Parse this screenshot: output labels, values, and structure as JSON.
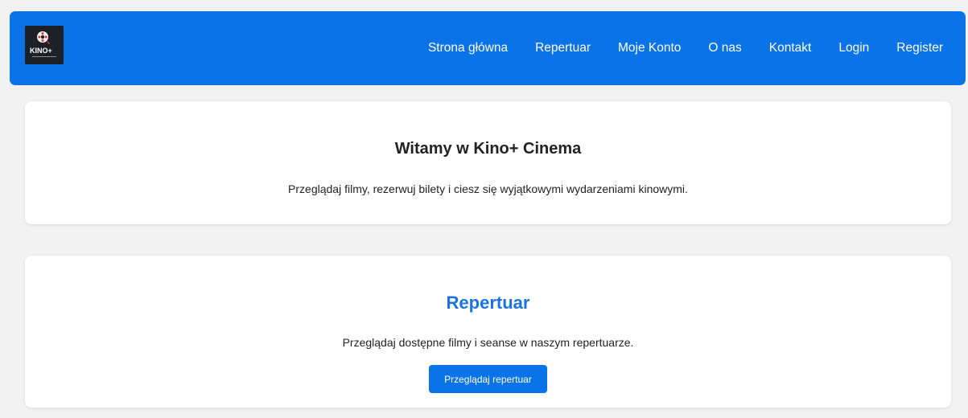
{
  "colors": {
    "navbar": "#0b73e8",
    "accent": "#1a73e0",
    "background": "#f2f2f2",
    "card": "#ffffff"
  },
  "nav": {
    "logo_icon": "kino-plus-logo-icon",
    "logo_text": "KINO+",
    "items": [
      {
        "label": "Strona główna"
      },
      {
        "label": "Repertuar"
      },
      {
        "label": "Moje Konto"
      },
      {
        "label": "O nas"
      },
      {
        "label": "Kontakt"
      },
      {
        "label": "Login"
      },
      {
        "label": "Register"
      }
    ]
  },
  "welcome": {
    "title": "Witamy w Kino+ Cinema",
    "text": "Przeglądaj filmy, rezerwuj bilety i ciesz się wyjątkowymi wydarzeniami kinowymi."
  },
  "repertoire": {
    "title": "Repertuar",
    "text": "Przeglądaj dostępne filmy i seanse w naszym repertuarze.",
    "button_label": "Przeglądaj repertuar"
  }
}
